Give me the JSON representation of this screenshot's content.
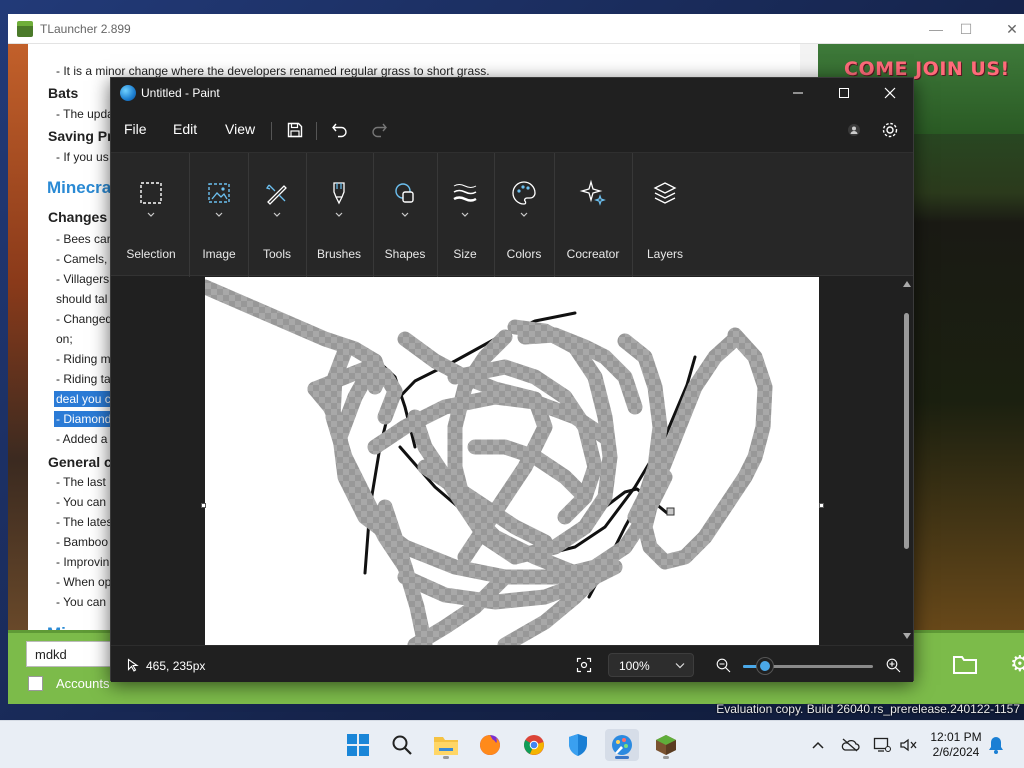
{
  "watermark": "Evaluation copy. Build 26040.rs_prerelease.240122-1157",
  "tlauncher": {
    "title": "TLauncher 2.899",
    "banner": "COME JOIN US!",
    "news_lines": [
      {
        "text": "- It is a minor change where the developers renamed regular grass to short grass.",
        "style": "line"
      },
      {
        "text": "Bats",
        "style": "h"
      },
      {
        "text": "- The upda",
        "style": "line"
      },
      {
        "text": "Saving Pr",
        "style": "h"
      },
      {
        "text": "- If you us",
        "style": "line"
      },
      {
        "text": "Minecra",
        "style": "h2"
      },
      {
        "text": "Changes",
        "style": "h"
      },
      {
        "text": "- Bees car",
        "style": "line"
      },
      {
        "text": "- Camels,",
        "style": "line"
      },
      {
        "text": "- Villagers",
        "style": "line"
      },
      {
        "text": "should tal",
        "style": "line"
      },
      {
        "text": "- Changed",
        "style": "line"
      },
      {
        "text": "on;",
        "style": "line"
      },
      {
        "text": "- Riding m",
        "style": "line"
      },
      {
        "text": "- Riding ta",
        "style": "line"
      },
      {
        "text": "deal you c",
        "style": "hl"
      },
      {
        "text": "- Diamond",
        "style": "hl"
      },
      {
        "text": "- Added a",
        "style": "line"
      },
      {
        "text": "General c",
        "style": "h"
      },
      {
        "text": "- The last",
        "style": "line"
      },
      {
        "text": "- You can",
        "style": "line"
      },
      {
        "text": "- The lates",
        "style": "line"
      },
      {
        "text": "- Bamboo",
        "style": "line"
      },
      {
        "text": "- Improvin",
        "style": "line"
      },
      {
        "text": "- When op",
        "style": "line"
      },
      {
        "text": "- You can",
        "style": "line"
      },
      {
        "text": "Minecra",
        "style": "h2"
      }
    ],
    "username": "mdkd",
    "accounts_label": "Accounts"
  },
  "paint": {
    "title": "Untitled - Paint",
    "menus": [
      "File",
      "Edit",
      "View"
    ],
    "ribbon": [
      "Selection",
      "Image",
      "Tools",
      "Brushes",
      "Shapes",
      "Size",
      "Colors",
      "Cocreator",
      "Layers"
    ],
    "coords": "465, 235px",
    "zoom": "100%",
    "zoom_slider_fraction": 0.17
  },
  "taskbar": {
    "time": "12:01 PM",
    "date": "2/6/2024"
  }
}
